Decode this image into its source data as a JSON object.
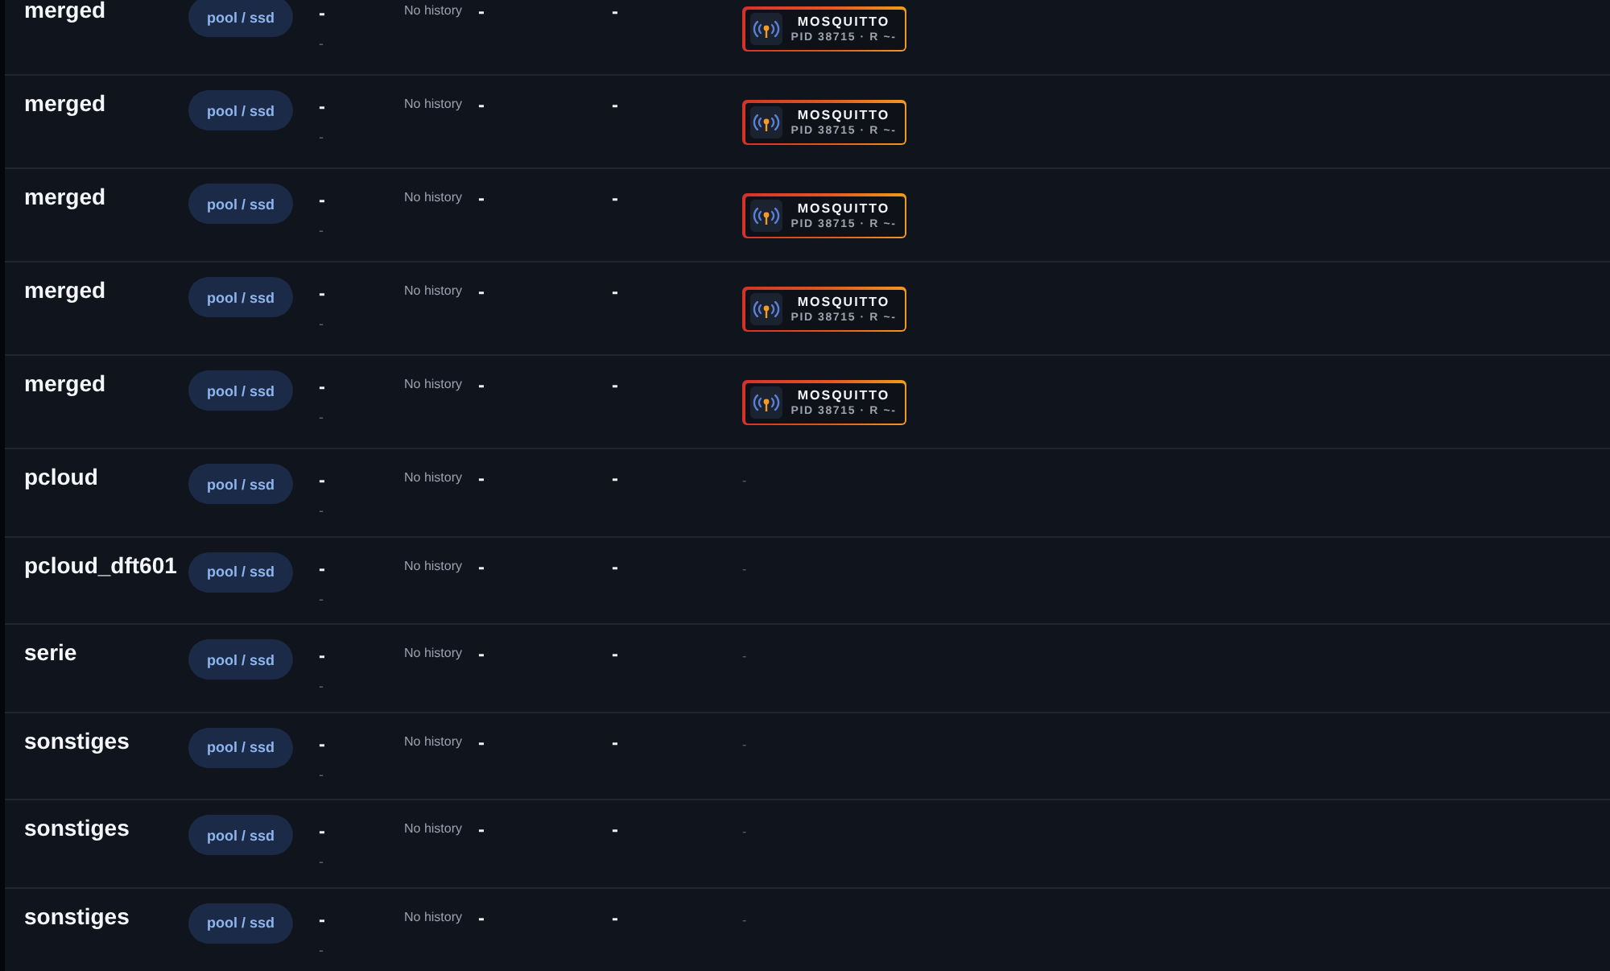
{
  "rows": [
    {
      "name": "merged",
      "tag": "pool / ssd",
      "column_3": {
        "value": "-",
        "sub": "-"
      },
      "history": "No history",
      "column_5": "-",
      "column_6": "-",
      "column_7": {
        "kind": "process",
        "name": "MOSQUITTO",
        "detail": "PID 38715 · R ~-"
      }
    },
    {
      "name": "merged",
      "tag": "pool / ssd",
      "column_3": {
        "value": "-",
        "sub": "-"
      },
      "history": "No history",
      "column_5": "-",
      "column_6": "-",
      "column_7": {
        "kind": "process",
        "name": "MOSQUITTO",
        "detail": "PID 38715 · R ~-"
      }
    },
    {
      "name": "merged",
      "tag": "pool / ssd",
      "column_3": {
        "value": "-",
        "sub": "-"
      },
      "history": "No history",
      "column_5": "-",
      "column_6": "-",
      "column_7": {
        "kind": "process",
        "name": "MOSQUITTO",
        "detail": "PID 38715 · R ~-"
      }
    },
    {
      "name": "merged",
      "tag": "pool / ssd",
      "column_3": {
        "value": "-",
        "sub": "-"
      },
      "history": "No history",
      "column_5": "-",
      "column_6": "-",
      "column_7": {
        "kind": "process",
        "name": "MOSQUITTO",
        "detail": "PID 38715 · R ~-"
      }
    },
    {
      "name": "merged",
      "tag": "pool / ssd",
      "column_3": {
        "value": "-",
        "sub": "-"
      },
      "history": "No history",
      "column_5": "-",
      "column_6": "-",
      "column_7": {
        "kind": "process",
        "name": "MOSQUITTO",
        "detail": "PID 38715 · R ~-"
      }
    },
    {
      "name": "pcloud",
      "tag": "pool / ssd",
      "column_3": {
        "value": "-",
        "sub": "-"
      },
      "history": "No history",
      "column_5": "-",
      "column_6": "-",
      "column_7": {
        "kind": "empty",
        "text": "-"
      }
    },
    {
      "name": "pcloud_dft601",
      "tag": "pool / ssd",
      "column_3": {
        "value": "-",
        "sub": "-"
      },
      "history": "No history",
      "column_5": "-",
      "column_6": "-",
      "column_7": {
        "kind": "empty",
        "text": "-"
      }
    },
    {
      "name": "serie",
      "tag": "pool / ssd",
      "column_3": {
        "value": "-",
        "sub": "-"
      },
      "history": "No history",
      "column_5": "-",
      "column_6": "-",
      "column_7": {
        "kind": "empty",
        "text": "-"
      }
    },
    {
      "name": "sonstiges",
      "tag": "pool / ssd",
      "column_3": {
        "value": "-",
        "sub": "-"
      },
      "history": "No history",
      "column_5": "-",
      "column_6": "-",
      "column_7": {
        "kind": "empty",
        "text": "-"
      }
    },
    {
      "name": "sonstiges",
      "tag": "pool / ssd",
      "column_3": {
        "value": "-",
        "sub": "-"
      },
      "history": "No history",
      "column_5": "-",
      "column_6": "-",
      "column_7": {
        "kind": "empty",
        "text": "-"
      }
    },
    {
      "name": "sonstiges",
      "tag": "pool / ssd",
      "column_3": {
        "value": "-",
        "sub": "-"
      },
      "history": "No history",
      "column_5": "-",
      "column_6": "-",
      "column_7": {
        "kind": "empty",
        "text": "-"
      }
    }
  ]
}
